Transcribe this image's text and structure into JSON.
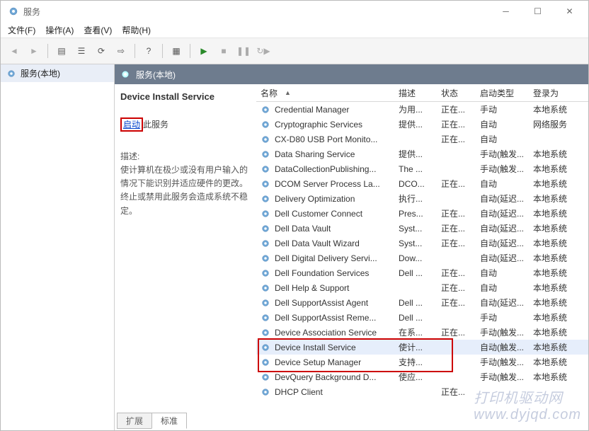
{
  "window": {
    "title": "服务"
  },
  "menubar": [
    "文件(F)",
    "操作(A)",
    "查看(V)",
    "帮助(H)"
  ],
  "toolbar_icons": [
    {
      "name": "back-icon",
      "glyph": "◄",
      "enabled": false
    },
    {
      "name": "forward-icon",
      "glyph": "►",
      "enabled": false
    },
    {
      "name": "sep"
    },
    {
      "name": "show-hide-tree-icon",
      "glyph": "▤",
      "enabled": true
    },
    {
      "name": "properties-icon",
      "glyph": "☰",
      "enabled": true
    },
    {
      "name": "refresh-icon",
      "glyph": "⟳",
      "enabled": true
    },
    {
      "name": "export-icon",
      "glyph": "⇨",
      "enabled": true
    },
    {
      "name": "sep"
    },
    {
      "name": "help-icon",
      "glyph": "?",
      "enabled": true
    },
    {
      "name": "sep"
    },
    {
      "name": "preview-icon",
      "glyph": "▦",
      "enabled": true
    },
    {
      "name": "sep"
    },
    {
      "name": "start-service-icon",
      "glyph": "▶",
      "enabled": true
    },
    {
      "name": "stop-service-icon",
      "glyph": "■",
      "enabled": false
    },
    {
      "name": "pause-service-icon",
      "glyph": "❚❚",
      "enabled": false
    },
    {
      "name": "restart-service-icon",
      "glyph": "↻▶",
      "enabled": false
    }
  ],
  "left_tree": {
    "node": "服务(本地)"
  },
  "header_local": "服务(本地)",
  "detail": {
    "title": "Device Install Service",
    "start_link_highlight": "启动",
    "start_link_rest": "此服务",
    "desc_label": "描述:",
    "desc_text": "使计算机在极少或没有用户输入的情况下能识别并适应硬件的更改。终止或禁用此服务会造成系统不稳定。"
  },
  "columns": {
    "name": "名称",
    "desc": "描述",
    "status": "状态",
    "startup": "启动类型",
    "logon": "登录为"
  },
  "services": [
    {
      "n": "Credential Manager",
      "d": "为用...",
      "s": "正在...",
      "t": "手动",
      "l": "本地系统"
    },
    {
      "n": "Cryptographic Services",
      "d": "提供...",
      "s": "正在...",
      "t": "自动",
      "l": "网络服务"
    },
    {
      "n": "CX-D80 USB Port Monito...",
      "d": "",
      "s": "正在...",
      "t": "自动",
      "l": ""
    },
    {
      "n": "Data Sharing Service",
      "d": "提供...",
      "s": "",
      "t": "手动(触发...",
      "l": "本地系统"
    },
    {
      "n": "DataCollectionPublishing...",
      "d": "The ...",
      "s": "",
      "t": "手动(触发...",
      "l": "本地系统"
    },
    {
      "n": "DCOM Server Process La...",
      "d": "DCO...",
      "s": "正在...",
      "t": "自动",
      "l": "本地系统"
    },
    {
      "n": "Delivery Optimization",
      "d": "执行...",
      "s": "",
      "t": "自动(延迟...",
      "l": "本地系统"
    },
    {
      "n": "Dell Customer Connect",
      "d": "Pres...",
      "s": "正在...",
      "t": "自动(延迟...",
      "l": "本地系统"
    },
    {
      "n": "Dell Data Vault",
      "d": "Syst...",
      "s": "正在...",
      "t": "自动(延迟...",
      "l": "本地系统"
    },
    {
      "n": "Dell Data Vault Wizard",
      "d": "Syst...",
      "s": "正在...",
      "t": "自动(延迟...",
      "l": "本地系统"
    },
    {
      "n": "Dell Digital Delivery Servi...",
      "d": "Dow...",
      "s": "",
      "t": "自动(延迟...",
      "l": "本地系统"
    },
    {
      "n": "Dell Foundation Services",
      "d": "Dell ...",
      "s": "正在...",
      "t": "自动",
      "l": "本地系统"
    },
    {
      "n": "Dell Help & Support",
      "d": "",
      "s": "正在...",
      "t": "自动",
      "l": "本地系统"
    },
    {
      "n": "Dell SupportAssist Agent",
      "d": "Dell ...",
      "s": "正在...",
      "t": "自动(延迟...",
      "l": "本地系统"
    },
    {
      "n": "Dell SupportAssist Reme...",
      "d": "Dell ...",
      "s": "",
      "t": "手动",
      "l": "本地系统"
    },
    {
      "n": "Device Association Service",
      "d": "在系...",
      "s": "正在...",
      "t": "手动(触发...",
      "l": "本地系统"
    },
    {
      "n": "Device Install Service",
      "d": "使计...",
      "s": "",
      "t": "自动(触发...",
      "l": "本地系统",
      "sel": true
    },
    {
      "n": "Device Setup Manager",
      "d": "支持...",
      "s": "",
      "t": "手动(触发...",
      "l": "本地系统"
    },
    {
      "n": "DevQuery Background D...",
      "d": "使应...",
      "s": "",
      "t": "手动(触发...",
      "l": "本地系统"
    },
    {
      "n": "DHCP Client",
      "d": "",
      "s": "正在...",
      "t": "",
      "l": ""
    }
  ],
  "tabs": {
    "extended": "扩展",
    "standard": "标准"
  },
  "watermark": "打印机驱动网\nwww.dyjqd.com"
}
